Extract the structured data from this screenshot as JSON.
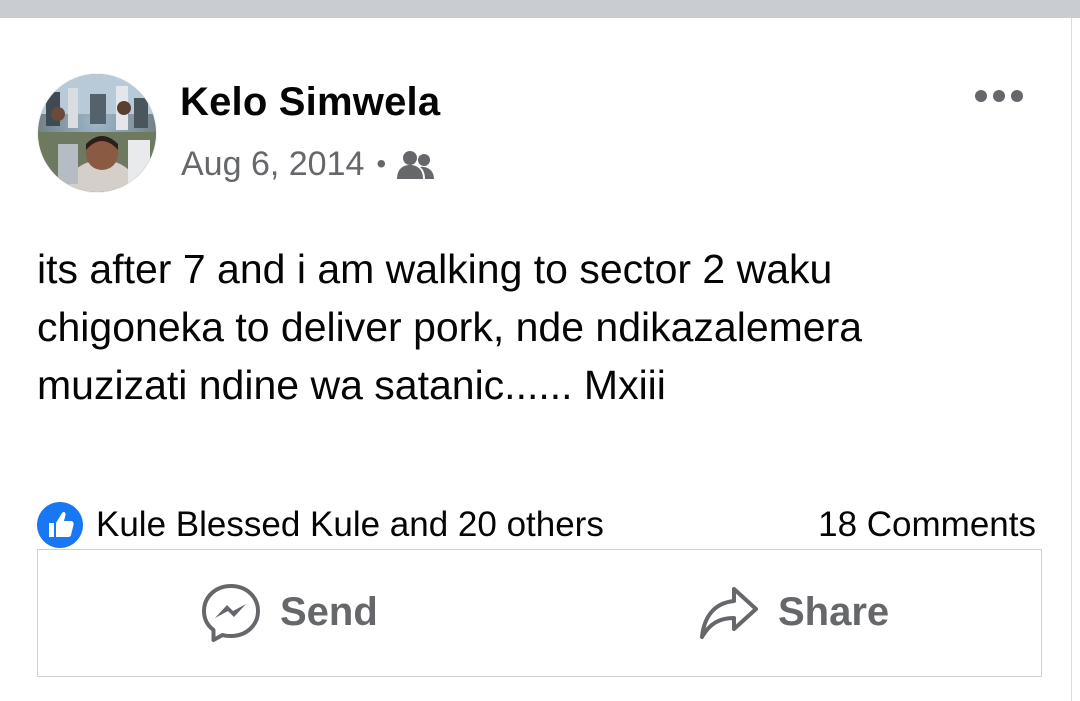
{
  "post": {
    "author_name": "Kelo Simwela",
    "date": "Aug 6, 2014",
    "separator": "•",
    "audience_icon": "friends-icon",
    "body_text": "its after 7 and i am walking to sector 2 waku\nchigoneka to deliver pork, nde ndikazalemera\nmuzizati ndine wa satanic...... Mxiii",
    "reactions_text": "Kule Blessed Kule and 20 others",
    "comments_text": "18 Comments"
  },
  "actions": {
    "send_label": "Send",
    "share_label": "Share"
  },
  "colors": {
    "like_blue": "#1877f2",
    "secondary_text": "#65676b",
    "primary_text": "#050505",
    "top_bar": "#c9ccd1"
  }
}
